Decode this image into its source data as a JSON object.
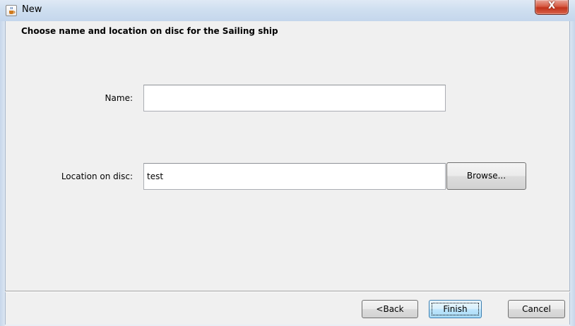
{
  "window": {
    "title": "New",
    "close_glyph": "X",
    "app_icon": "java-cup-icon"
  },
  "wizard": {
    "heading": "Choose name and location on disc for the Sailing ship",
    "name_label": "Name:",
    "name_value": "",
    "location_label": "Location on disc:",
    "location_value": "test",
    "browse_label": "Browse..."
  },
  "footer": {
    "back_label": "<Back",
    "finish_label": "Finish",
    "cancel_label": "Cancel"
  },
  "colors": {
    "close_button": "#c2331b",
    "finish_focus": "#3c7fb1"
  }
}
